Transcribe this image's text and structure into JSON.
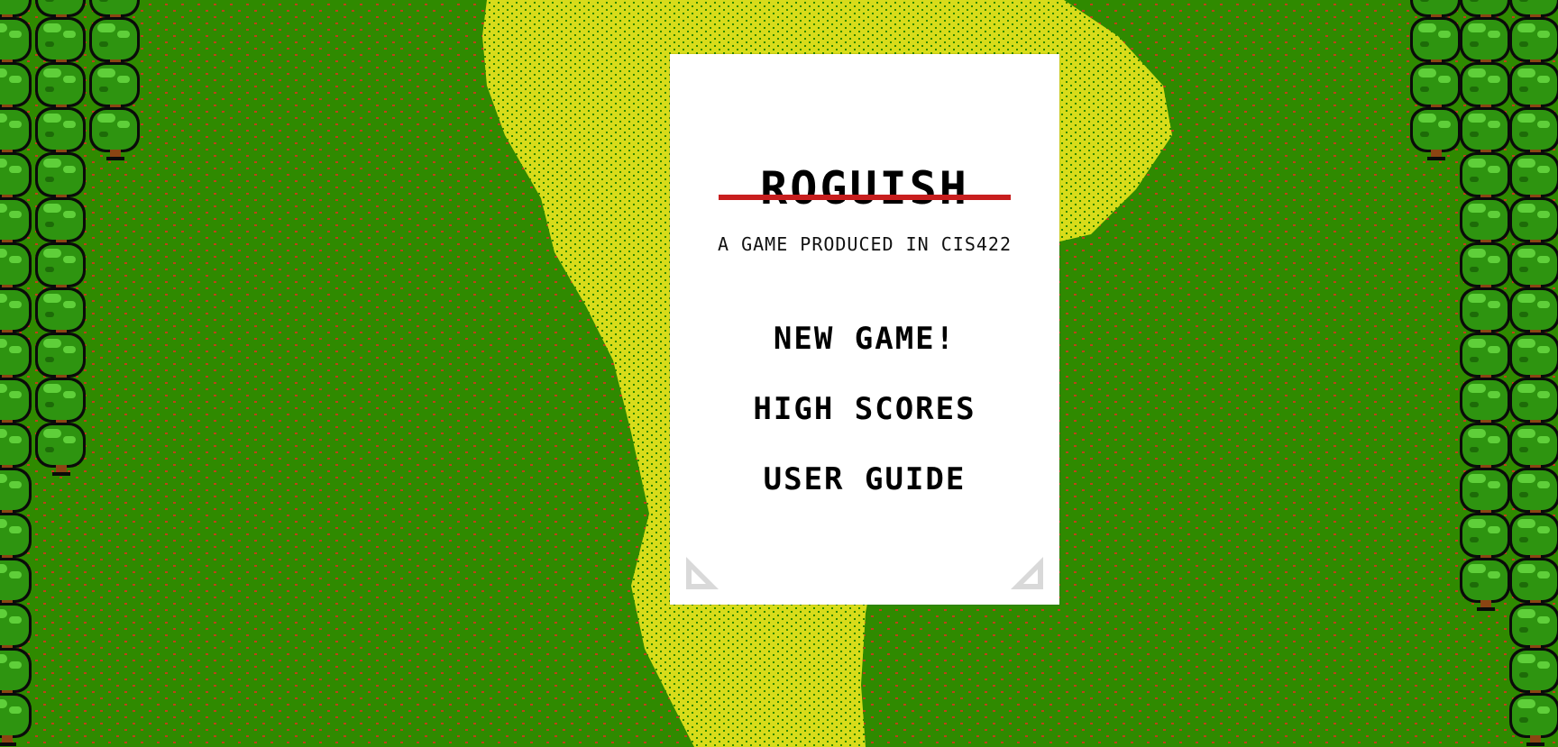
{
  "game": {
    "title": "ROGUISH",
    "subtitle": "A GAME PRODUCED IN CIS422"
  },
  "menu": {
    "items": [
      {
        "label": "NEW GAME!"
      },
      {
        "label": "HIGH SCORES"
      },
      {
        "label": "USER GUIDE"
      }
    ]
  },
  "colors": {
    "grass": "#2f8a00",
    "grass_speck": "#c0401a",
    "path": "#d8dc1a",
    "path_speck": "#2f8a00",
    "tree_leaf": "#2e9410",
    "tree_leaf_light": "#5fcf3a",
    "tree_outline": "#0a0a0a",
    "trunk": "#8b4513",
    "card": "#ffffff",
    "title_rule": "#c81e1e"
  }
}
